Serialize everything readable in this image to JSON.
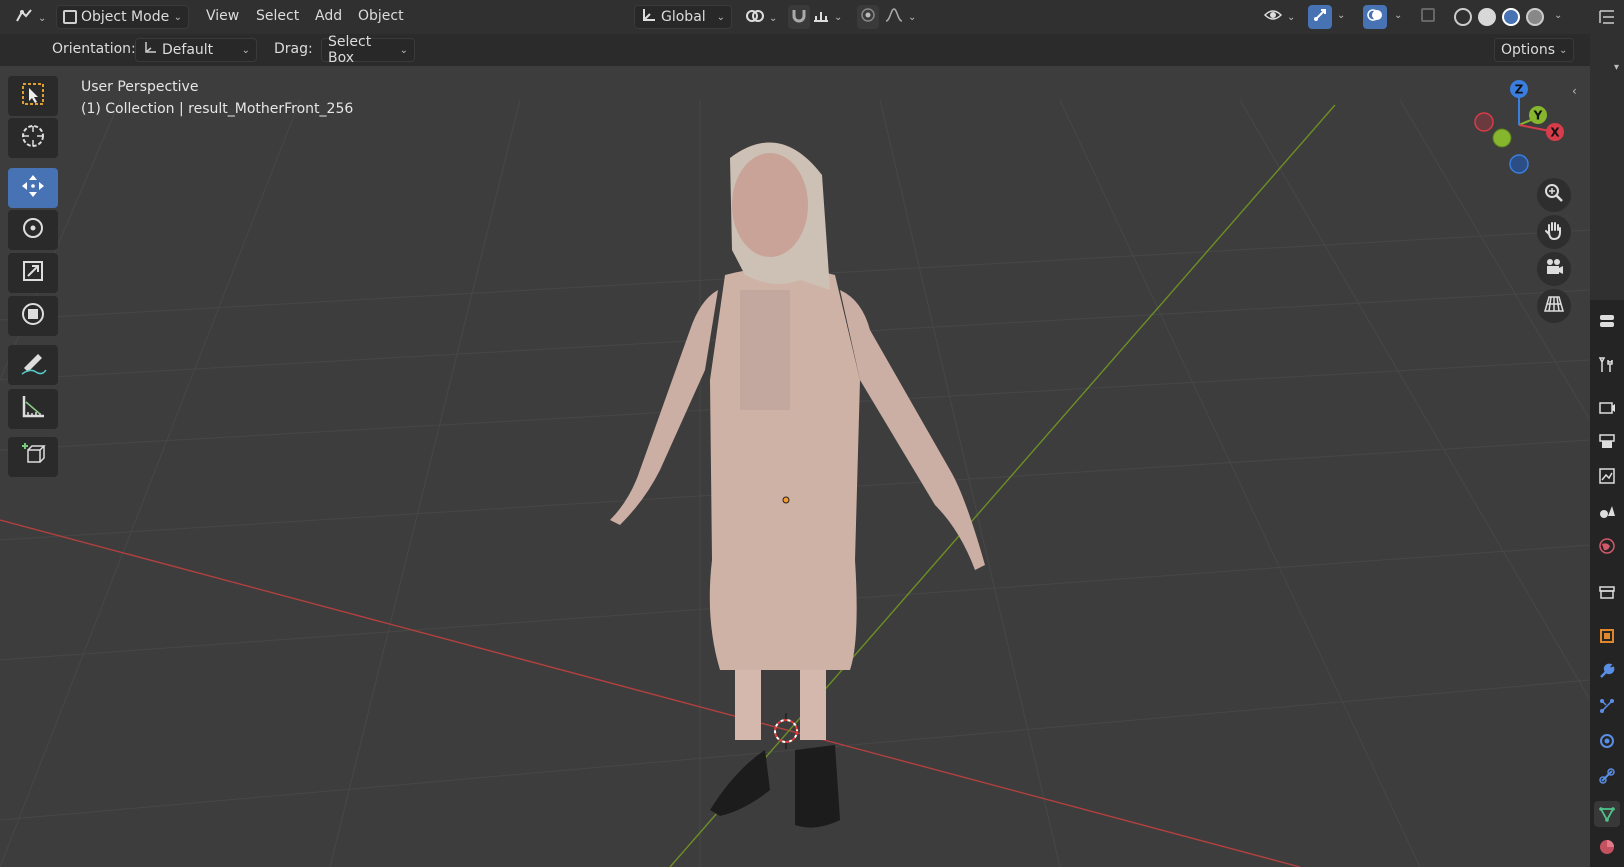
{
  "header": {
    "mode_label": "Object Mode",
    "menus": [
      "View",
      "Select",
      "Add",
      "Object"
    ],
    "transform_space": "Global"
  },
  "subheader": {
    "orientation_label": "Orientation:",
    "orientation_value": "Default",
    "drag_label": "Drag:",
    "drag_value": "Select Box",
    "options_label": "Options"
  },
  "viewport": {
    "view_name": "User Perspective",
    "collection_info": "(1) Collection | result_MotherFront_256"
  },
  "gizmo": {
    "z": "Z",
    "y": "Y",
    "x": "X"
  },
  "tools": [
    "select-box",
    "cursor",
    "move",
    "rotate",
    "scale",
    "transform",
    "annotate",
    "measure",
    "add-cube"
  ],
  "active_tool": "move",
  "colors": {
    "accent": "#4772b3",
    "x_axis": "#d63c4a",
    "y_axis": "#86b62d",
    "z_axis": "#3a7ee0",
    "bg": "#3d3d3d"
  }
}
